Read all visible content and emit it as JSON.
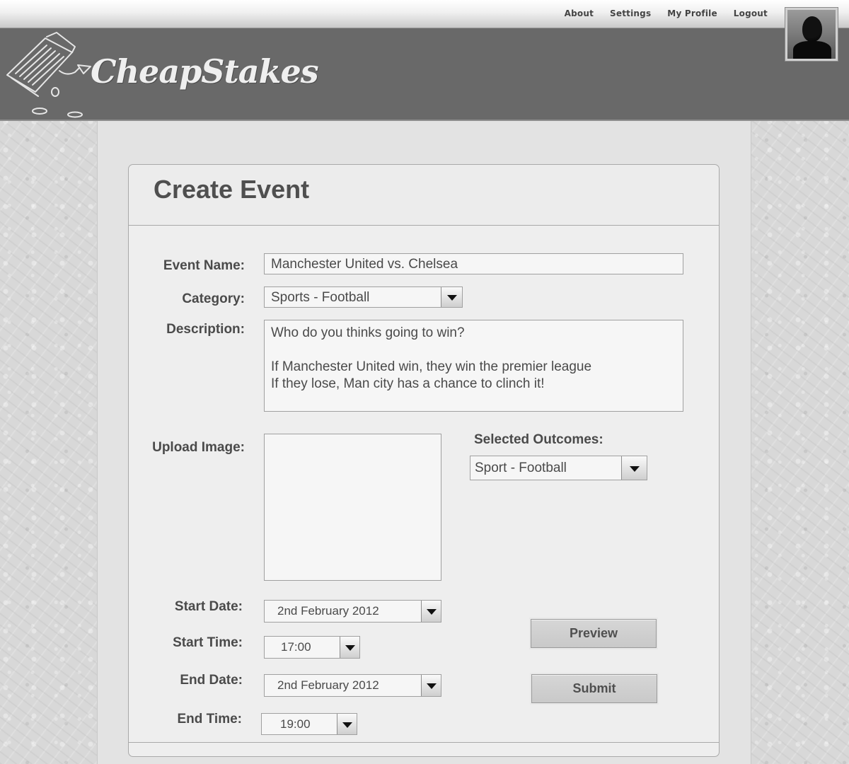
{
  "topnav": {
    "links": [
      "About",
      "Settings",
      "My Profile",
      "Logout"
    ]
  },
  "brand": {
    "name": "CheapStakes"
  },
  "form": {
    "title": "Create Event",
    "event_name": {
      "label": "Event Name:",
      "value": "Manchester United vs. Chelsea"
    },
    "category": {
      "label": "Category:",
      "value": "Sports - Football"
    },
    "description": {
      "label": "Description:",
      "value": "Who do you thinks going to win?\n\nIf Manchester United win, they win the premier league\nIf they lose, Man city has a chance to clinch it!"
    },
    "upload_image": {
      "label": "Upload Image:"
    },
    "selected_outcomes": {
      "label": "Selected Outcomes:",
      "value": "Sport - Football"
    },
    "start_date": {
      "label": "Start Date:",
      "value": "2nd February 2012"
    },
    "start_time": {
      "label": "Start Time:",
      "value": "17:00"
    },
    "end_date": {
      "label": "End Date:",
      "value": "2nd February 2012"
    },
    "end_time": {
      "label": "End Time:",
      "value": "19:00"
    },
    "preview_label": "Preview",
    "submit_label": "Submit"
  },
  "icons": [
    "logo-icon",
    "avatar-icon",
    "chevron-down-icon"
  ],
  "colors": {
    "header": "#696969",
    "panel": "#eeeeee",
    "text": "#4a4a4a"
  }
}
